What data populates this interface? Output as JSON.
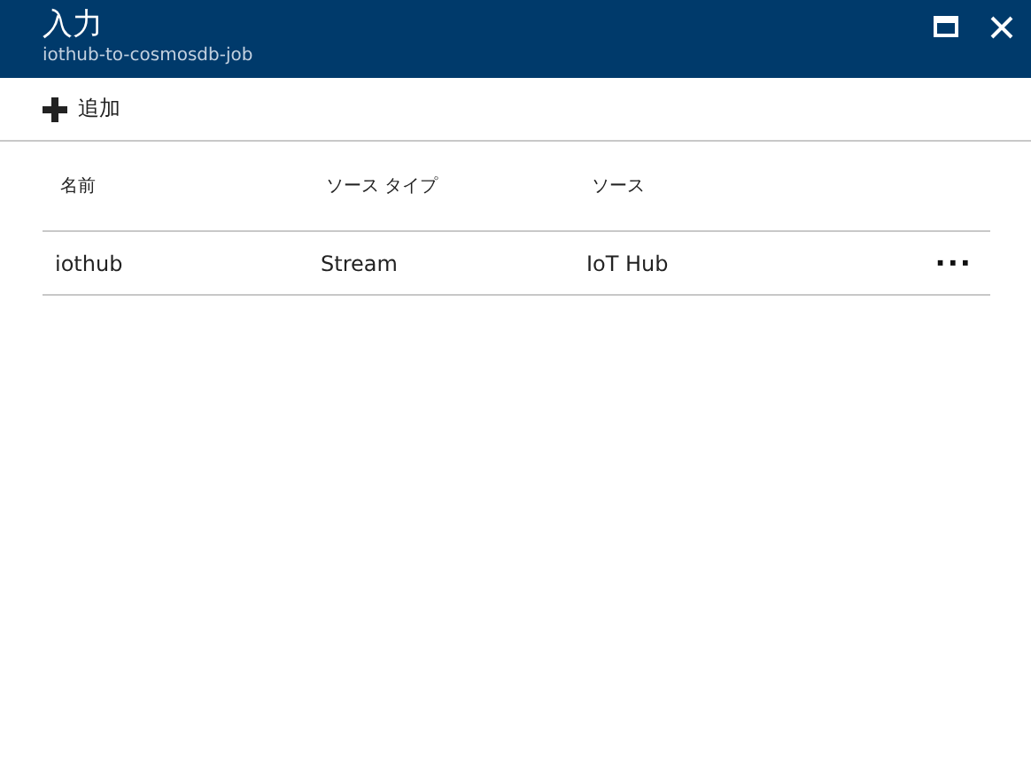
{
  "window": {
    "title": "入力",
    "subtitle": "iothub-to-cosmosdb-job"
  },
  "toolbar": [
    {
      "kind": "add",
      "label": "追加"
    }
  ],
  "table": {
    "columns": [
      "名前",
      "ソース タイプ",
      "ソース"
    ],
    "rows": [
      {
        "cells": [
          "iothub",
          "Stream",
          "IoT Hub"
        ],
        "menu": "···"
      }
    ]
  }
}
